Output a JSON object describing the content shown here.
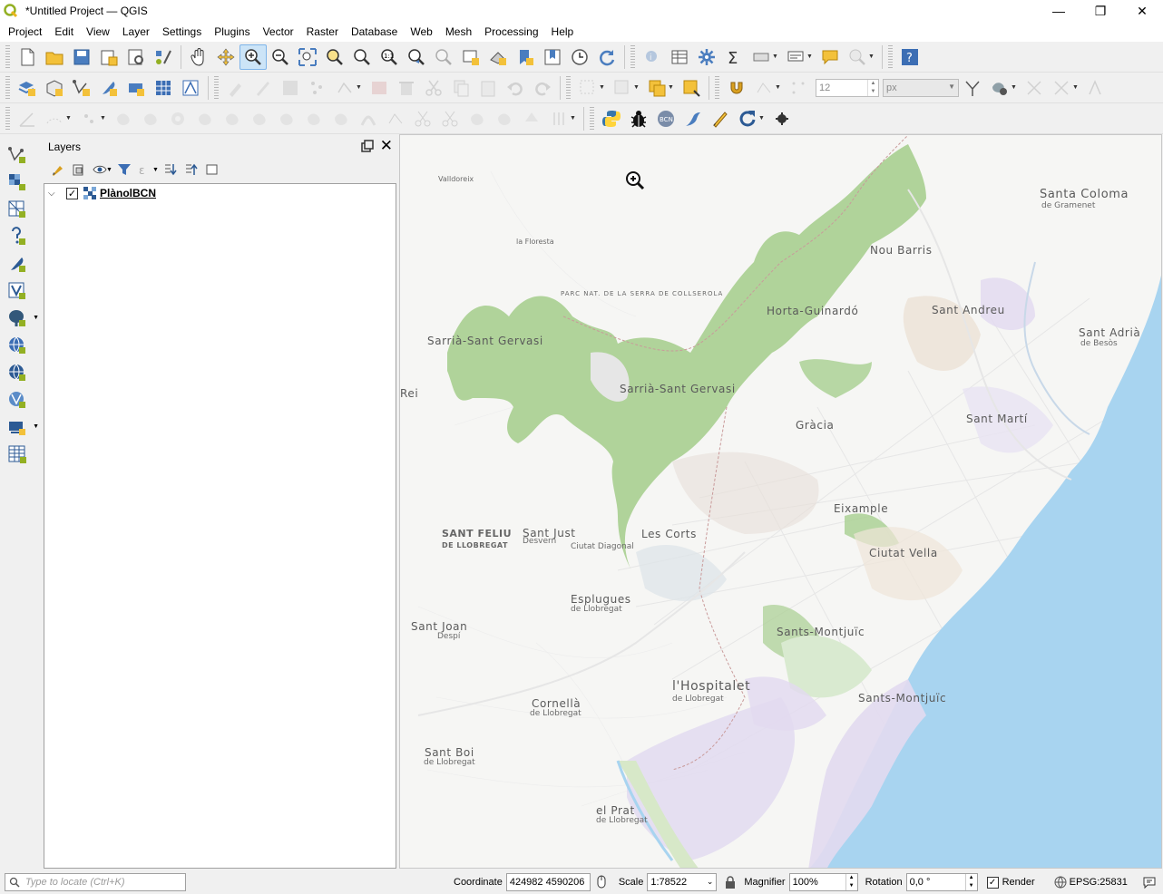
{
  "window": {
    "title": "*Untitled Project — QGIS",
    "controls": {
      "minimize": "—",
      "restore": "❐",
      "close": "✕"
    }
  },
  "menu": [
    "Project",
    "Edit",
    "View",
    "Layer",
    "Settings",
    "Plugins",
    "Vector",
    "Raster",
    "Database",
    "Web",
    "Mesh",
    "Processing",
    "Help"
  ],
  "toolbar": {
    "snapping_tolerance": "12",
    "snapping_unit": "px"
  },
  "layers_panel": {
    "title": "Layers",
    "float_icon": "float-icon",
    "close_icon": "close-icon",
    "layers": [
      {
        "name": "PlànolBCN",
        "checked": true,
        "expanded": true
      }
    ]
  },
  "map": {
    "labels": {
      "santa_coloma": "Santa Coloma",
      "de_gramenet": "de Gramenet",
      "nou_barris": "Nou Barris",
      "horta": "Horta-Guinardó",
      "sant_andreu": "Sant Andreu",
      "sant_adria": "Sant Adrià",
      "de_besos": "de Besòs",
      "sarria1": "Sarrià-Sant Gervasi",
      "sarria2": "Sarrià-Sant Gervasi",
      "rei": "Rei",
      "gracia": "Gràcia",
      "sant_marti": "Sant Martí",
      "eixample": "Eixample",
      "sant_feliu": "SANT FELIU",
      "de_llobregat_sf": "DE LLOBREGAT",
      "sant_just": "Sant Just",
      "desvern": "Desvern",
      "ciutat_diagonal": "Ciutat Diagonal",
      "les_corts": "Les Corts",
      "ciutat_vella": "Ciutat Vella",
      "esplugues": "Esplugues",
      "de_llobregat_es": "de Llobregat",
      "sant_joan": "Sant Joan",
      "despi": "Despí",
      "sants": "Sants-Montjuïc",
      "hospitalet": "l'Hospitalet",
      "de_llobregat_h": "de Llobregat",
      "sants2": "Sants-Montjuïc",
      "cornella": "Cornellà",
      "de_llobregat_c": "de Llobregat",
      "sant_boi": "Sant Boi",
      "de_llobregat_sb": "de Llobregat",
      "el_prat": "el Prat",
      "de_llobregat_p": "de Llobregat",
      "parc": "PARC NAT. DE LA SERRA DE COLLSEROLA",
      "valldoreix": "Valldoreix",
      "la_floresta": "la Floresta"
    },
    "colors": {
      "sea": "#a8d4f0",
      "park": "#a8cf90",
      "land": "#f6f6f4",
      "industrial": "#e2daf0"
    }
  },
  "status": {
    "locator_placeholder": "Type to locate (Ctrl+K)",
    "coordinate_label": "Coordinate",
    "coordinate_value": "424982 4590206",
    "scale_label": "Scale",
    "scale_value": "1:78522",
    "magnifier_label": "Magnifier",
    "magnifier_value": "100%",
    "rotation_label": "Rotation",
    "rotation_value": "0,0 °",
    "render_label": "Render",
    "render_checked": true,
    "crs": "EPSG:25831"
  }
}
